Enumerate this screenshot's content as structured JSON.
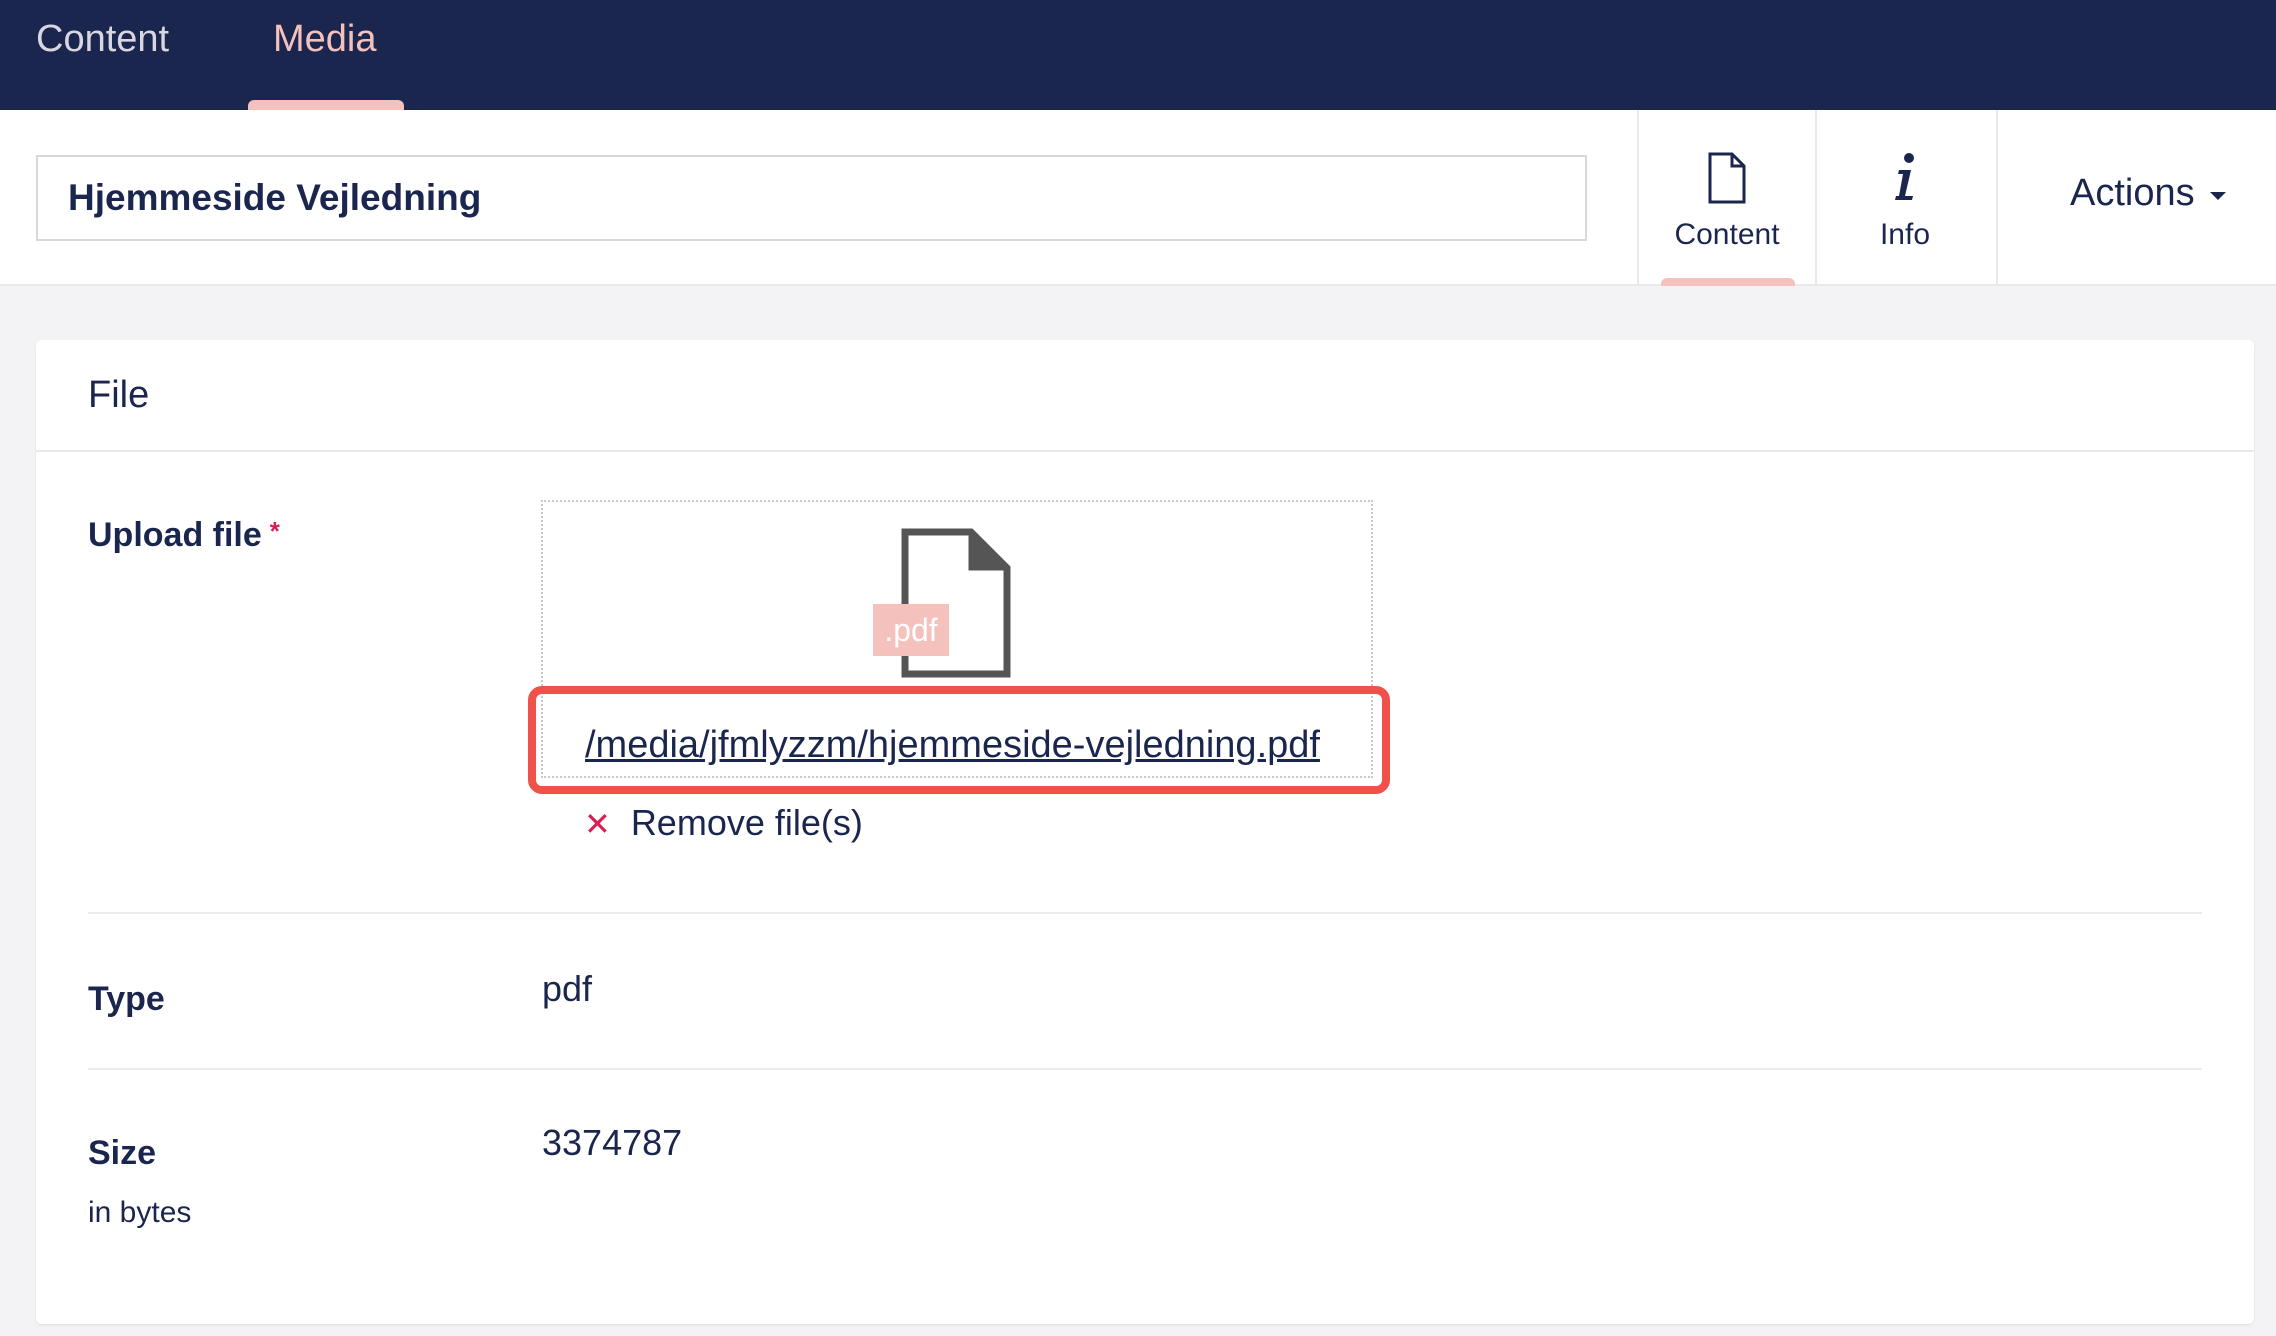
{
  "topnav": {
    "items": [
      {
        "label": "Content",
        "active": false
      },
      {
        "label": "Media",
        "active": true
      }
    ]
  },
  "header": {
    "name_value": "Hjemmeside Vejledning",
    "apps": [
      {
        "label": "Content",
        "icon": "document-icon",
        "active": true
      },
      {
        "label": "Info",
        "icon": "info-icon",
        "active": false
      }
    ],
    "actions_label": "Actions"
  },
  "panel": {
    "title": "File",
    "upload": {
      "label": "Upload file",
      "required": "*",
      "badge": ".pdf",
      "file_path": "/media/jfmlyzzm/hjemmeside-vejledning.pdf",
      "remove_label": "Remove file(s)"
    },
    "type": {
      "label": "Type",
      "value": "pdf"
    },
    "size": {
      "label": "Size",
      "description": "in bytes",
      "value": "3374787"
    }
  },
  "colors": {
    "nav_bg": "#1b264f",
    "accent": "#f5c1bc",
    "highlight": "#f0524b",
    "danger": "#d42054"
  }
}
